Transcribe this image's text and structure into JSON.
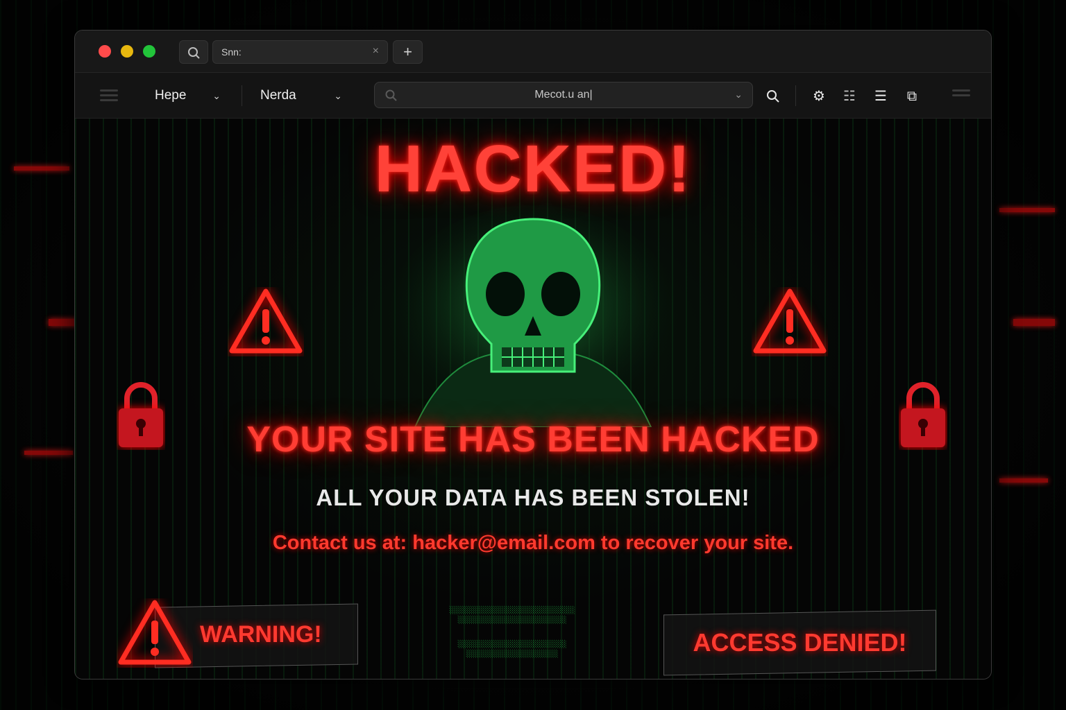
{
  "browser": {
    "tab_title": "Snn:",
    "tab_close": "×",
    "new_tab": "+",
    "nav_items": [
      {
        "label": "Hepe"
      },
      {
        "label": "Nerda"
      }
    ],
    "address_value": "Mecot.u an|"
  },
  "page": {
    "title": "HACKED!",
    "headline": "YOUR SITE HAS BEEN HACKED",
    "subheadline": "ALL YOUR DATA HAS BEEN  STOLEN!",
    "contact": "Contact us at: hacker@email.com to recover your site.",
    "warning_label": "WARNING!",
    "access_label": "ACCESS  DENIED!"
  },
  "colors": {
    "accent_red": "#ff3b30",
    "matrix_green": "#1fa13f",
    "window_bg": "#0a0a0a"
  },
  "icons": {
    "toolbar": [
      "search-icon",
      "gear-icon",
      "list-icon",
      "menu-icon",
      "extension-icon"
    ],
    "decorative": [
      "warning-triangle-icon",
      "padlock-icon",
      "skull-icon"
    ]
  }
}
